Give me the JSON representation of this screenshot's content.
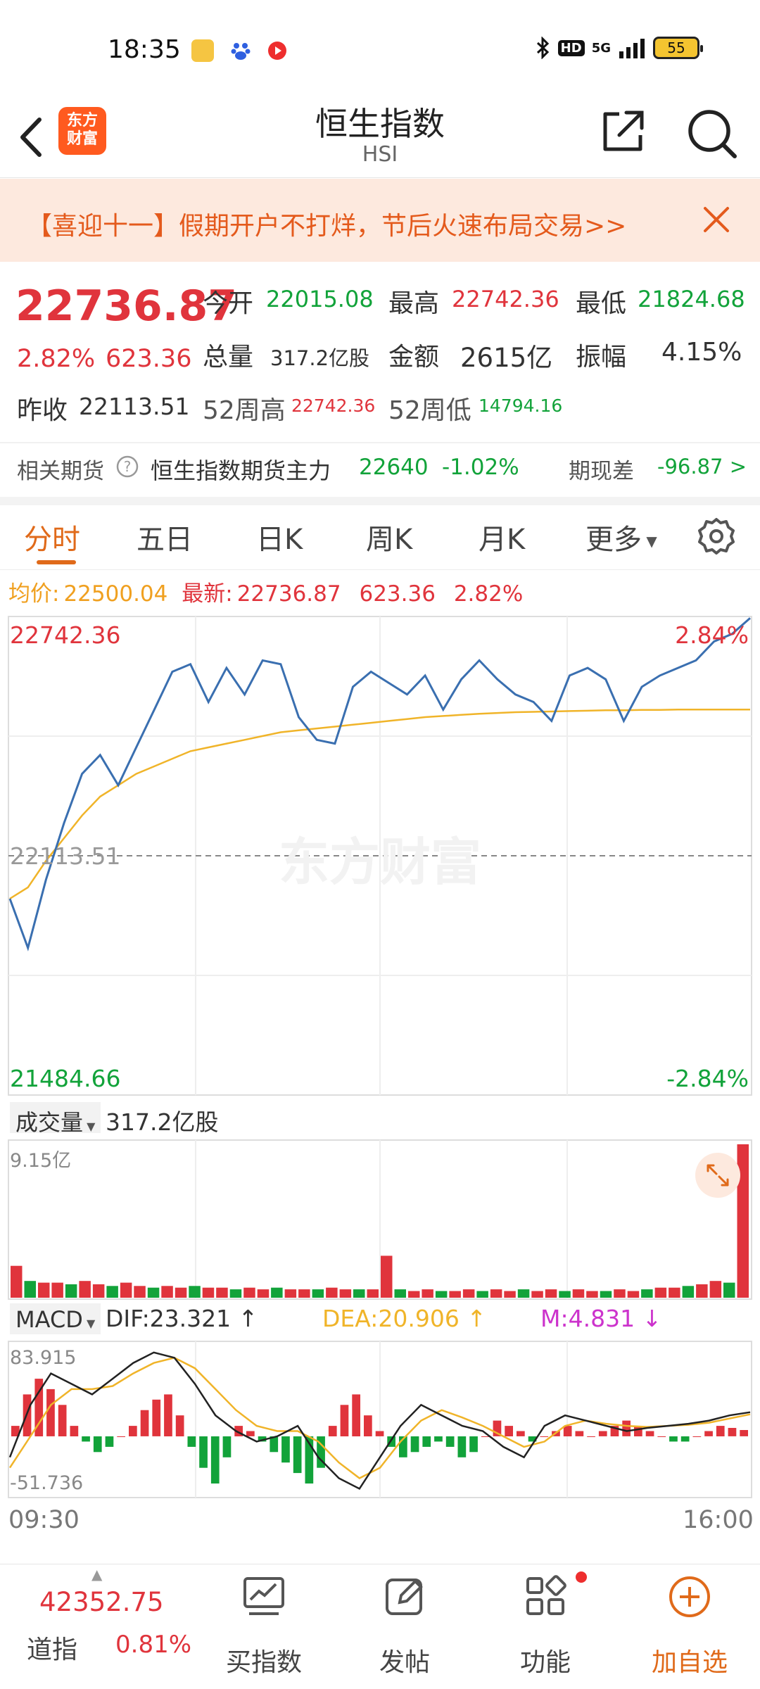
{
  "status_bar": {
    "time": "18:35",
    "network": "5G",
    "hd": "HD",
    "battery": "55"
  },
  "header": {
    "title": "恒生指数",
    "subtitle": "HSI",
    "brand_logo": "东方\n财富",
    "icons": [
      "back-arrow-icon",
      "share-icon",
      "search-icon"
    ]
  },
  "promo": {
    "text": "【喜迎十一】假期开户不打烊，节后火速布局交易>>"
  },
  "quote": {
    "price": "22736.87",
    "change_pct": "2.82%",
    "change_abs": "623.36",
    "open_label": "今开",
    "open": "22015.08",
    "high_label": "最高",
    "high": "22742.36",
    "low_label": "最低",
    "low": "21824.68",
    "volume_label": "总量",
    "volume": "317.2亿股",
    "amount_label": "金额",
    "amount": "2615亿",
    "amplitude_label": "振幅",
    "amplitude": "4.15%",
    "prev_close_label": "昨收",
    "prev_close": "22113.51",
    "wk52_high_label": "52周高",
    "wk52_high": "22742.36",
    "wk52_low_label": "52周低",
    "wk52_low": "14794.16"
  },
  "futures": {
    "label": "相关期货",
    "name": "恒生指数期货主力",
    "price": "22640",
    "change": "-1.02%",
    "basis_label": "期现差",
    "basis": "-96.87 >"
  },
  "tabs": [
    "分时",
    "五日",
    "日K",
    "周K",
    "月K",
    "更多"
  ],
  "avg_row": {
    "avg_label": "均价:",
    "avg": "22500.04",
    "latest_label": "最新:",
    "latest": "22736.87",
    "change": "623.36",
    "pct": "2.82%"
  },
  "intraday_chart": {
    "top_left": "22742.36",
    "top_right": "2.84%",
    "mid": "22113.51",
    "bottom_left": "21484.66",
    "bottom_right": "-2.84%",
    "watermark": "东方财富"
  },
  "volume_panel": {
    "selector": "成交量",
    "total": "317.2亿股",
    "max_label": "9.15亿"
  },
  "macd_panel": {
    "selector": "MACD",
    "dif": "DIF:23.321",
    "dea": "DEA:20.906",
    "m": "M:4.831",
    "top_label": "83.915",
    "bottom_label": "-51.736"
  },
  "time_axis": {
    "start": "09:30",
    "end": "16:00"
  },
  "bottom_bar": {
    "dow_value": "42352.75",
    "dow_label": "道指",
    "dow_pct": "0.81%",
    "buy_index": "买指数",
    "post": "发帖",
    "features": "功能",
    "add_watch": "加自选"
  },
  "colors": {
    "up": "#e0343c",
    "down": "#12a33a",
    "accent": "#e06a1a",
    "price_line": "#3a6fb0",
    "avg_line": "#f0b429",
    "dea_line": "#f0b429",
    "m_color": "#cc33cc"
  },
  "chart_data": [
    {
      "type": "line",
      "title": "",
      "x": [
        "09:30",
        "16:00"
      ],
      "ylim": [
        21484.66,
        22742.36
      ],
      "reference": 22113.51,
      "series": [
        {
          "values": [
            22000,
            21870,
            22050,
            22200,
            22330,
            22380,
            22300,
            22400,
            22500,
            22600,
            22620,
            22520,
            22610,
            22540,
            22630,
            22620,
            22480,
            22420,
            22410,
            22560,
            22600,
            22570,
            22540,
            22590,
            22500,
            22580,
            22630,
            22580,
            22540,
            22520,
            22470,
            22590,
            22610,
            22580,
            22470,
            22560,
            22590,
            22610,
            22630,
            22680,
            22700,
            22742
          ]
        },
        {
          "values": [
            22000,
            22030,
            22100,
            22160,
            22220,
            22270,
            22300,
            22330,
            22350,
            22370,
            22390,
            22400,
            22410,
            22420,
            22430,
            22440,
            22445,
            22450,
            22455,
            22460,
            22465,
            22470,
            22475,
            22480,
            22483,
            22486,
            22489,
            22491,
            22493,
            22494,
            22495,
            22496,
            22497,
            22498,
            22498,
            22499,
            22499,
            22500,
            22500,
            22500,
            22500,
            22500
          ]
        }
      ]
    },
    {
      "type": "bar",
      "ylim": [
        0,
        9.15
      ],
      "values": [
        1.9,
        1.0,
        0.9,
        0.9,
        0.8,
        1.0,
        0.8,
        0.7,
        0.9,
        0.7,
        0.6,
        0.7,
        0.6,
        0.7,
        0.6,
        0.6,
        0.5,
        0.6,
        0.5,
        0.6,
        0.5,
        0.5,
        0.5,
        0.6,
        0.5,
        0.5,
        0.5,
        2.5,
        0.5,
        0.4,
        0.5,
        0.4,
        0.4,
        0.5,
        0.4,
        0.5,
        0.4,
        0.5,
        0.4,
        0.5,
        0.4,
        0.5,
        0.4,
        0.4,
        0.5,
        0.4,
        0.5,
        0.6,
        0.6,
        0.7,
        0.8,
        1.0,
        0.9,
        9.15
      ]
    },
    {
      "type": "bar",
      "ylim": [
        -51.736,
        83.915
      ],
      "series": [
        {
          "name": "MACD",
          "values": [
            10,
            40,
            55,
            45,
            30,
            10,
            -5,
            -15,
            -10,
            0,
            10,
            25,
            35,
            40,
            20,
            -10,
            -30,
            -45,
            -20,
            10,
            5,
            -5,
            -15,
            -25,
            -35,
            -45,
            -30,
            10,
            30,
            40,
            20,
            5,
            -10,
            -20,
            -15,
            -10,
            -5,
            -10,
            -20,
            -15,
            0,
            15,
            10,
            5,
            -5,
            0,
            5,
            10,
            5,
            0,
            5,
            10,
            15,
            10,
            5,
            0,
            -5,
            -5,
            0,
            5,
            10,
            8,
            6
          ]
        },
        {
          "name": "DIF",
          "values": [
            -20,
            30,
            60,
            50,
            40,
            55,
            70,
            80,
            75,
            50,
            20,
            5,
            -5,
            0,
            10,
            -20,
            -40,
            -50,
            -20,
            10,
            30,
            20,
            10,
            5,
            -10,
            -20,
            10,
            20,
            15,
            10,
            5,
            8,
            10,
            12,
            15,
            20,
            23
          ]
        },
        {
          "name": "DEA",
          "values": [
            -30,
            0,
            30,
            45,
            45,
            48,
            60,
            70,
            75,
            65,
            45,
            25,
            10,
            5,
            5,
            -5,
            -25,
            -40,
            -30,
            -5,
            15,
            25,
            18,
            10,
            0,
            -10,
            -5,
            10,
            15,
            12,
            10,
            9,
            10,
            11,
            13,
            17,
            21
          ]
        }
      ]
    }
  ]
}
